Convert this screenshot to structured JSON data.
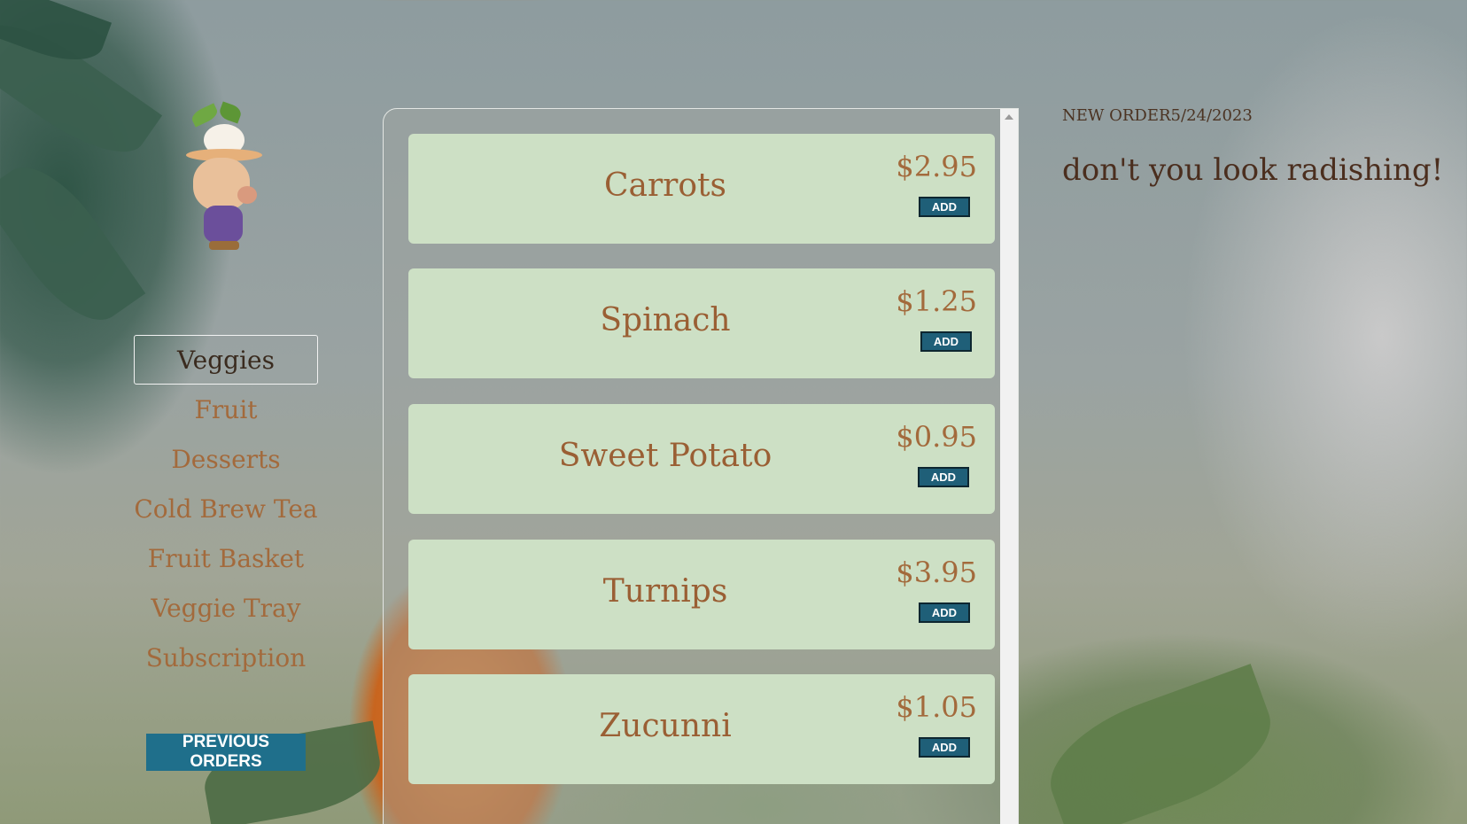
{
  "sidebar": {
    "nav": [
      {
        "label": "Veggies",
        "active": true
      },
      {
        "label": "Fruit"
      },
      {
        "label": "Desserts"
      },
      {
        "label": "Cold Brew Tea"
      },
      {
        "label": "Fruit Basket"
      },
      {
        "label": "Veggie Tray"
      },
      {
        "label": "Subscription"
      }
    ],
    "previous_orders_label": "PREVIOUS ORDERS"
  },
  "products": [
    {
      "name": "Carrots",
      "price": "$2.95",
      "add_label": "ADD"
    },
    {
      "name": "Spinach",
      "price": "$1.25",
      "add_label": "ADD"
    },
    {
      "name": "Sweet Potato",
      "price": "$0.95",
      "add_label": "ADD"
    },
    {
      "name": "Turnips",
      "price": "$3.95",
      "add_label": "ADD"
    },
    {
      "name": "Zucunni",
      "price": "$1.05",
      "add_label": "ADD"
    }
  ],
  "order": {
    "header": "NEW ORDER5/24/2023",
    "tagline": "don't you look radishing!"
  },
  "colors": {
    "card_bg": "#cde0c5",
    "accent_button": "#1f6f8b",
    "nav_text": "#a36a3c",
    "price_text": "#a36a3c"
  }
}
